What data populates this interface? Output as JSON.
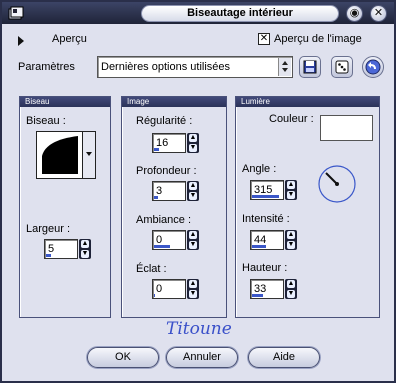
{
  "window": {
    "title": "Biseautage intérieur"
  },
  "titlebar": {
    "minimize_glyph": "◉",
    "close_glyph": "✕"
  },
  "preview": {
    "label": "Aperçu",
    "image_preview_label": "Aperçu de l'image",
    "image_preview_checked": true
  },
  "settings": {
    "label": "Paramètres",
    "selected": "Dernières options utilisées"
  },
  "bevel": {
    "header": "Biseau",
    "bevel_label": "Biseau :",
    "width_label": "Largeur :",
    "width_value": "5",
    "width_fill": 0.15
  },
  "image": {
    "header": "Image",
    "smoothness_label": "Régularité :",
    "smoothness_value": "16",
    "smoothness_fill": 0.16,
    "depth_label": "Profondeur :",
    "depth_value": "3",
    "depth_fill": 0.12,
    "ambience_label": "Ambiance :",
    "ambience_value": "0",
    "ambience_fill": 0.5,
    "shine_label": "Éclat :",
    "shine_value": "0",
    "shine_fill": 0.02
  },
  "light": {
    "header": "Lumière",
    "color_label": "Couleur :",
    "color_value": "#ffffff",
    "angle_label": "Angle :",
    "angle_value": "315",
    "angle_fill": 0.87,
    "intensity_label": "Intensité :",
    "intensity_value": "44",
    "intensity_fill": 0.44,
    "elevation_label": "Hauteur :",
    "elevation_value": "33",
    "elevation_fill": 0.36
  },
  "signature": "Titoune",
  "buttons": {
    "ok": "OK",
    "cancel": "Annuler",
    "help": "Aide"
  }
}
